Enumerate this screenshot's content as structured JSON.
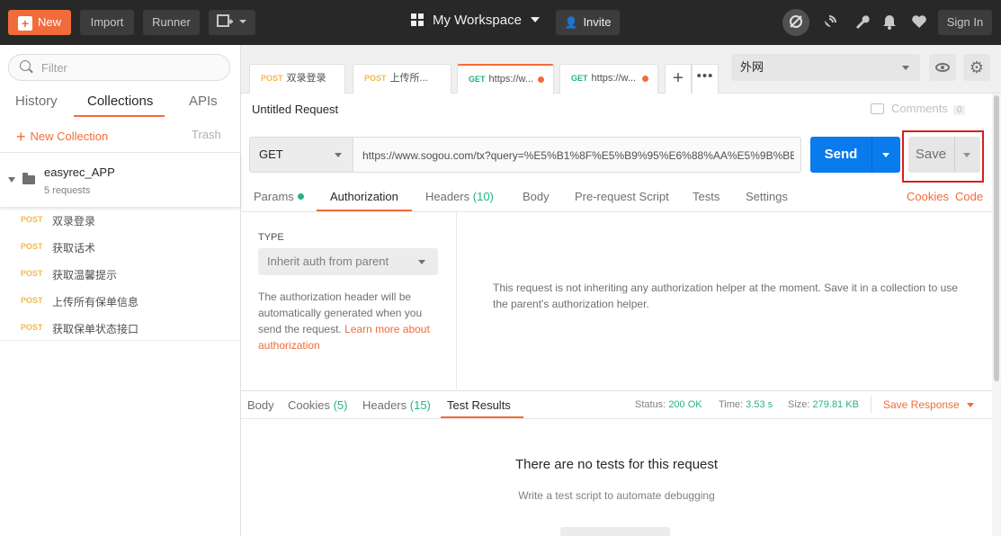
{
  "topbar": {
    "new_label": "New",
    "import_label": "Import",
    "runner_label": "Runner",
    "workspace_label": "My Workspace",
    "invite_label": "Invite",
    "signin_label": "Sign In"
  },
  "sidebar": {
    "filter_placeholder": "Filter",
    "tabs": [
      "History",
      "Collections",
      "APIs"
    ],
    "new_collection_label": "New Collection",
    "trash_label": "Trash",
    "collection": {
      "name": "easyrec_APP",
      "count": "5 requests"
    },
    "requests": [
      {
        "method": "POST",
        "name": "双录登录"
      },
      {
        "method": "POST",
        "name": "获取话术"
      },
      {
        "method": "POST",
        "name": "获取温馨提示"
      },
      {
        "method": "POST",
        "name": "上传所有保单信息"
      },
      {
        "method": "POST",
        "name": "获取保单状态接口"
      }
    ]
  },
  "request_tabs": [
    {
      "method": "POST",
      "name": "双录登录"
    },
    {
      "method": "POST",
      "name": "上传所..."
    },
    {
      "method": "GET",
      "name": "https://w..."
    },
    {
      "method": "GET",
      "name": "https://w..."
    }
  ],
  "environment": {
    "selected": "外网"
  },
  "request": {
    "title": "Untitled Request",
    "comments_label": "Comments",
    "comments_count": "0",
    "method": "GET",
    "url": "https://www.sogou.com/tx?query=%E5%B1%8F%E5%B9%95%E6%88%AA%E5%9B%BE",
    "send_label": "Send",
    "save_label": "Save"
  },
  "subtabs": {
    "params": "Params",
    "authorization": "Authorization",
    "headers": "Headers",
    "headers_count": "(10)",
    "body": "Body",
    "prerequest": "Pre-request Script",
    "tests": "Tests",
    "settings": "Settings",
    "cookies": "Cookies",
    "code": "Code"
  },
  "auth": {
    "type_label": "TYPE",
    "type_value": "Inherit auth from parent",
    "desc": "The authorization header will be automatically generated when you send the request. ",
    "learn_more": "Learn more about authorization",
    "info": "This request is not inheriting any authorization helper at the moment. Save it in a collection to use the parent's authorization helper."
  },
  "response": {
    "tabs": {
      "body": "Body",
      "cookies": "Cookies",
      "cookies_count": "(5)",
      "headers": "Headers",
      "headers_count": "(15)",
      "test_results": "Test Results"
    },
    "status_label": "Status:",
    "status_value": "200 OK",
    "time_label": "Time:",
    "time_value": "3.53 s",
    "size_label": "Size:",
    "size_value": "279.81 KB",
    "save_response": "Save Response",
    "no_tests_title": "There are no tests for this request",
    "no_tests_sub": "Write a test script to automate debugging"
  }
}
